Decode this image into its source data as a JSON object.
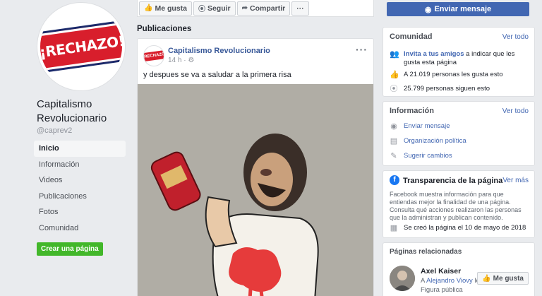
{
  "page": {
    "logo_text": "¡RECHAZO!",
    "name_line1": "Capitalismo",
    "name_line2": "Revolucionario",
    "handle": "@caprev2",
    "create_page_label": "Crear una página"
  },
  "nav": [
    {
      "label": "Inicio",
      "active": true
    },
    {
      "label": "Información"
    },
    {
      "label": "Videos"
    },
    {
      "label": "Publicaciones"
    },
    {
      "label": "Fotos"
    },
    {
      "label": "Comunidad"
    }
  ],
  "toolbar": {
    "like_label": "Me gusta",
    "follow_label": "Seguir",
    "share_label": "Compartir",
    "more_label": "···",
    "send_message_label": "Enviar mensaje"
  },
  "feed": {
    "section_title": "Publicaciones",
    "post": {
      "author": "Capitalismo Revolucionario",
      "time": "14 h ·",
      "more": "···",
      "text": "y despues se va a saludar a la primera risa"
    }
  },
  "community": {
    "title": "Comunidad",
    "see_all": "Ver todo",
    "invite_link": "Invita a tus amigos",
    "invite_rest": " a indicar que les gusta esta página",
    "likes_text": "A 21.019 personas les gusta esto",
    "followers_text": "25.799 personas siguen esto"
  },
  "info": {
    "title": "Información",
    "see_all": "Ver todo",
    "send_message": "Enviar mensaje",
    "category": "Organización política",
    "suggest": "Sugerir cambios"
  },
  "transparency": {
    "title": "Transparencia de la página",
    "see_more": "Ver más",
    "description": "Facebook muestra información para que entiendas mejor la finalidad de una página. Consulta qué acciones realizaron las personas que la administran y publican contenido.",
    "created": "Se creó la página el 10 de mayo de 2018"
  },
  "related": {
    "title": "Páginas relacionadas",
    "name": "Axel Kaiser",
    "friend_prefix": "A ",
    "friend_name": "Alejandro Viovy",
    "friend_suffix": " le g...",
    "category": "Figura pública",
    "like_label": "Me gusta"
  },
  "colors": {
    "brand": "#4267b2",
    "link": "#385898",
    "logo_red": "#d81e2c",
    "create_green": "#42b72a"
  },
  "icons": [
    "thumbs-up-icon",
    "rss-icon",
    "share-icon",
    "messenger-icon",
    "people-icon",
    "folder-icon",
    "pencil-icon",
    "calendar-icon",
    "facebook-icon"
  ]
}
